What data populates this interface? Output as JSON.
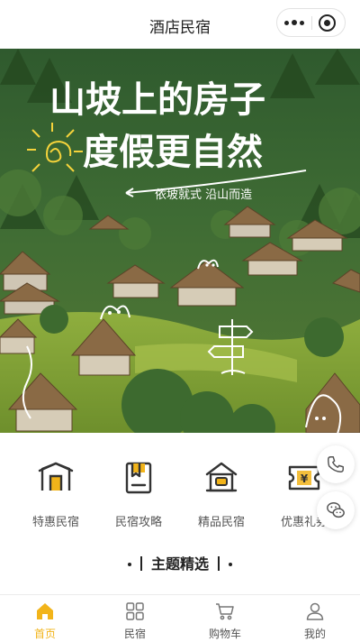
{
  "header": {
    "title": "酒店民宿"
  },
  "banner": {
    "title_line1": "山坡上的房子",
    "title_line2": "度假更自然",
    "tagline": "依坡就式  沿山而造"
  },
  "categories": [
    {
      "label": "特惠民宿",
      "icon": "discount-house-icon"
    },
    {
      "label": "民宿攻略",
      "icon": "guide-book-icon"
    },
    {
      "label": "精品民宿",
      "icon": "boutique-house-icon"
    },
    {
      "label": "优惠礼券",
      "icon": "coupon-ticket-icon"
    }
  ],
  "section": {
    "title": "主题精选"
  },
  "tabbar": {
    "items": [
      {
        "label": "首页",
        "icon": "home-icon",
        "active": true
      },
      {
        "label": "民宿",
        "icon": "grid-icon",
        "active": false
      },
      {
        "label": "购物车",
        "icon": "cart-icon",
        "active": false
      },
      {
        "label": "我的",
        "icon": "user-icon",
        "active": false
      }
    ]
  },
  "colors": {
    "accent": "#f2b41a",
    "text": "#333333"
  }
}
